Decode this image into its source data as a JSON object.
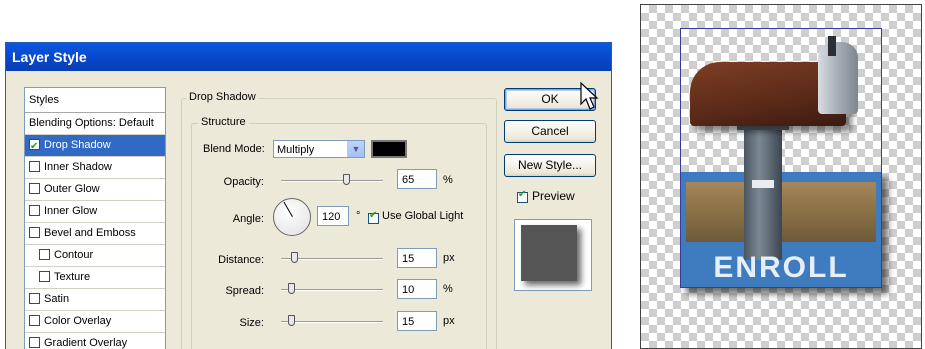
{
  "dialog": {
    "title": "Layer Style",
    "styles_header": "Styles",
    "blending_options": "Blending Options: Default",
    "style_items": [
      {
        "label": "Drop Shadow",
        "checked": true,
        "selected": true
      },
      {
        "label": "Inner Shadow",
        "checked": false
      },
      {
        "label": "Outer Glow",
        "checked": false
      },
      {
        "label": "Inner Glow",
        "checked": false
      },
      {
        "label": "Bevel and Emboss",
        "checked": false
      },
      {
        "label": "Contour",
        "checked": false
      },
      {
        "label": "Texture",
        "checked": false
      },
      {
        "label": "Satin",
        "checked": false
      },
      {
        "label": "Color Overlay",
        "checked": false
      },
      {
        "label": "Gradient Overlay",
        "checked": false
      }
    ],
    "group_title": "Drop Shadow",
    "subgroup_title": "Structure",
    "blend_mode_label": "Blend Mode:",
    "blend_mode_value": "Multiply",
    "shadow_color": "#000000",
    "opacity_label": "Opacity:",
    "opacity_value": "65",
    "opacity_unit": "%",
    "angle_label": "Angle:",
    "angle_value": "120",
    "angle_unit": "°",
    "use_global_light_label": "Use Global Light",
    "use_global_light_checked": true,
    "distance_label": "Distance:",
    "distance_value": "15",
    "distance_unit": "px",
    "spread_label": "Spread:",
    "spread_value": "10",
    "spread_unit": "%",
    "size_label": "Size:",
    "size_value": "15",
    "size_unit": "px",
    "ok_label": "OK",
    "cancel_label": "Cancel",
    "new_style_label": "New Style...",
    "preview_label": "Preview",
    "preview_checked": true
  },
  "artwork": {
    "caption": "ENROLL",
    "accent": "#3f7bbf"
  },
  "colors": {
    "titlebar": "#0846c8",
    "selection": "#316ac5",
    "dialog_bg": "#ece9d8"
  }
}
